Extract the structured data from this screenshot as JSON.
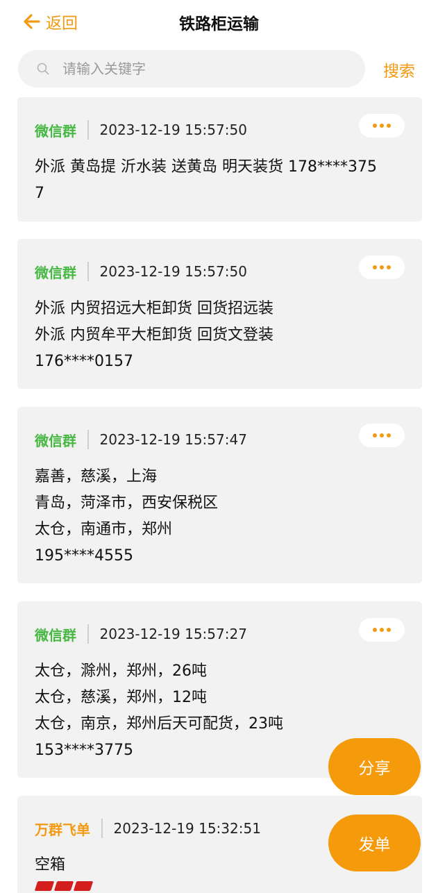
{
  "header": {
    "back_label": "返回",
    "title": "铁路柜运输"
  },
  "search": {
    "placeholder": "请输入关键字",
    "button_label": "搜索"
  },
  "posts": [
    {
      "source": "微信群",
      "time": "2023-12-19 15:57:50",
      "text": "外派 黄岛提 沂水装 送黄岛 明天装货 178****375\n7"
    },
    {
      "source": "微信群",
      "time": "2023-12-19 15:57:50",
      "text": "外派 内贸招远大柜卸货 回货招远装\n外派 内贸牟平大柜卸货 回货文登装\n176****0157"
    },
    {
      "source": "微信群",
      "time": "2023-12-19 15:57:47",
      "text": "嘉善，慈溪，上海\n青岛，菏泽市，西安保税区\n太仓，南通市，郑州\n195****4555"
    },
    {
      "source": "微信群",
      "time": "2023-12-19 15:57:27",
      "text": "太仓，滁州，郑州，26吨\n太仓，慈溪，郑州，12吨\n太仓，南京，郑州后天可配货，23吨\n153****3775"
    },
    {
      "source": "万群飞单",
      "time": "2023-12-19 15:32:51",
      "text": "空箱"
    }
  ],
  "fab": {
    "share_label": "分享",
    "post_label": "发单"
  },
  "colors": {
    "accent": "#f39a11",
    "wechat_green": "#47b843",
    "card_bg": "#f2f2f2"
  }
}
